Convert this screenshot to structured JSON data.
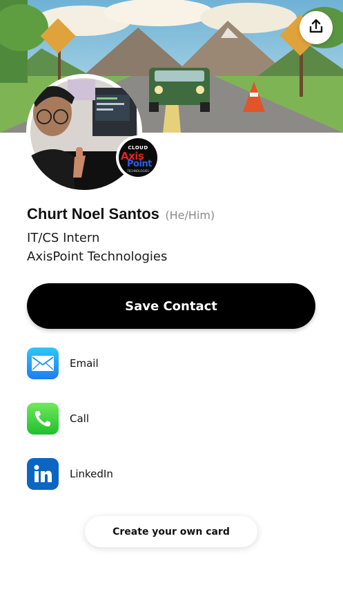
{
  "cover": {
    "image": "cartoon-road-landscape-with-green-car"
  },
  "header": {
    "share_icon": "share-upload-icon"
  },
  "profile": {
    "photo": "profile-photo-thumbs-up",
    "name": "Churt Noel Santos",
    "pronouns": "(He/Him)",
    "title": "IT/CS Intern",
    "company": "AxisPoint Technologies"
  },
  "logo": {
    "line1": "CLOUD",
    "line2": "Axis",
    "line3": "Point",
    "line4": "TECHNOLOGIES"
  },
  "actions": {
    "save_label": "Save Contact"
  },
  "links": [
    {
      "label": "Email",
      "icon": "email-icon",
      "color": "#1d8ef5"
    },
    {
      "label": "Call",
      "icon": "phone-icon",
      "color": "#34c83a"
    },
    {
      "label": "LinkedIn",
      "icon": "linkedin-icon",
      "color": "#0a66c2"
    }
  ],
  "footer": {
    "create_label": "Create your own card"
  }
}
